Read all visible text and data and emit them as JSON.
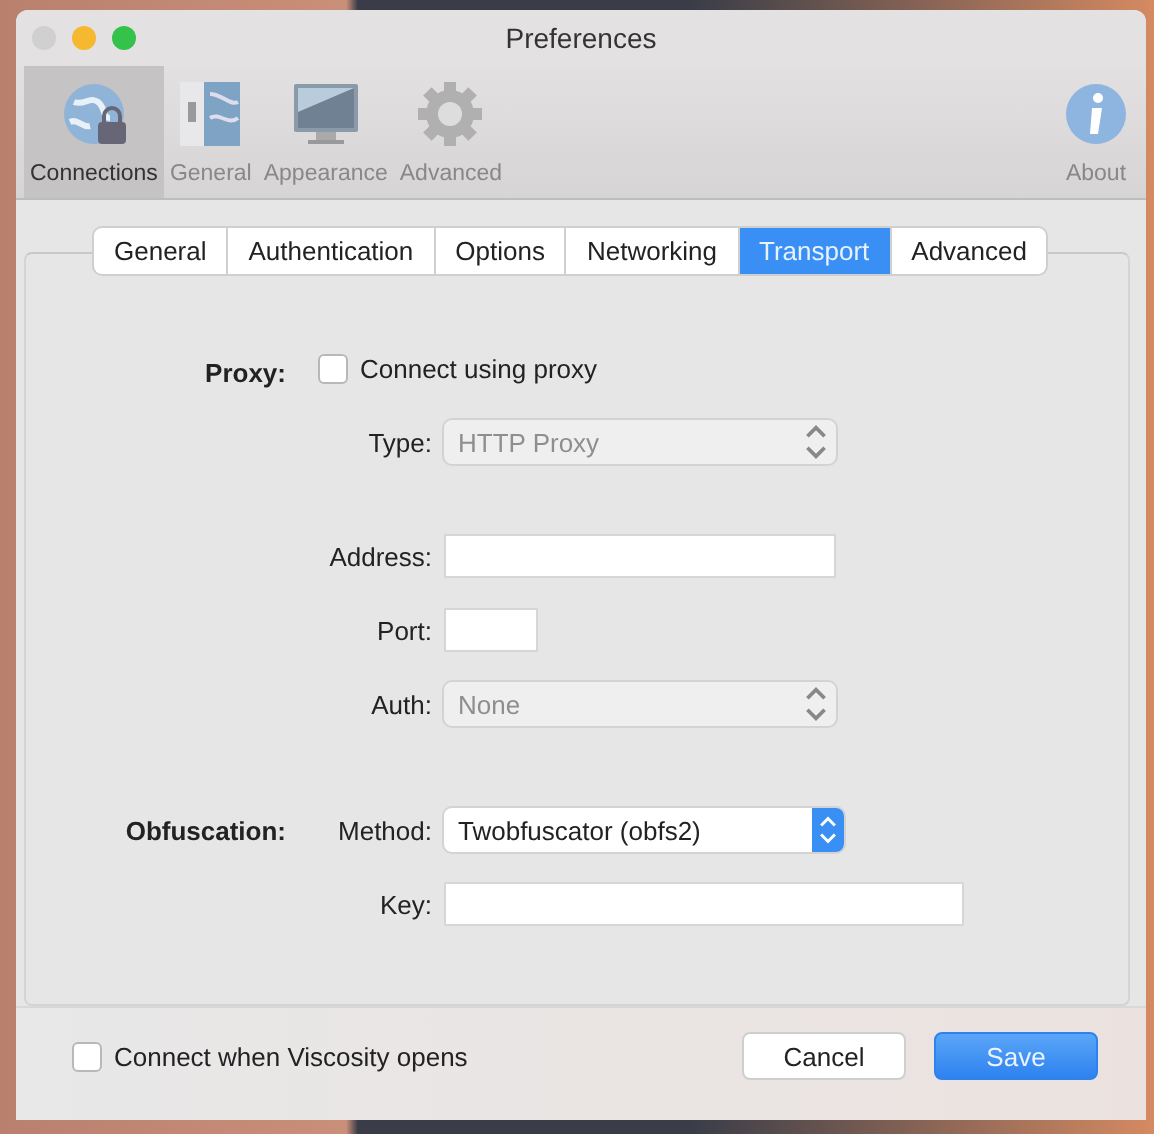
{
  "window": {
    "title": "Preferences"
  },
  "toolbar": [
    {
      "label": "Connections",
      "selected": true
    },
    {
      "label": "General",
      "selected": false
    },
    {
      "label": "Appearance",
      "selected": false
    },
    {
      "label": "Advanced",
      "selected": false
    },
    {
      "label": "About",
      "selected": false
    }
  ],
  "tabs": [
    {
      "label": "General",
      "selected": false
    },
    {
      "label": "Authentication",
      "selected": false
    },
    {
      "label": "Options",
      "selected": false
    },
    {
      "label": "Networking",
      "selected": false
    },
    {
      "label": "Transport",
      "selected": true
    },
    {
      "label": "Advanced",
      "selected": false
    }
  ],
  "form": {
    "sections": [
      {
        "label": "Proxy:",
        "rows": [
          {
            "kind": "checkbox",
            "label": "Connect using proxy",
            "checked": false
          },
          {
            "kind": "select",
            "label": "Type:",
            "value": "HTTP Proxy",
            "disabled": true
          },
          {
            "kind": "field",
            "label": "Address:"
          },
          {
            "kind": "field",
            "label": "Port:"
          },
          {
            "kind": "select",
            "label": "Auth:",
            "value": "None",
            "disabled": true
          }
        ]
      },
      {
        "label": "Obfuscation:",
        "rows": [
          {
            "kind": "select",
            "label": "Method:",
            "value": "Twobfuscator (obfs2)",
            "disabled": false
          },
          {
            "kind": "field",
            "label": "Key:"
          }
        ]
      }
    ]
  },
  "footer": {
    "checkbox": {
      "label": "Connect when Viscosity opens",
      "checked": false
    },
    "buttons": [
      {
        "label": "Cancel",
        "kind": "default"
      },
      {
        "label": "Save",
        "kind": "primary"
      }
    ]
  }
}
